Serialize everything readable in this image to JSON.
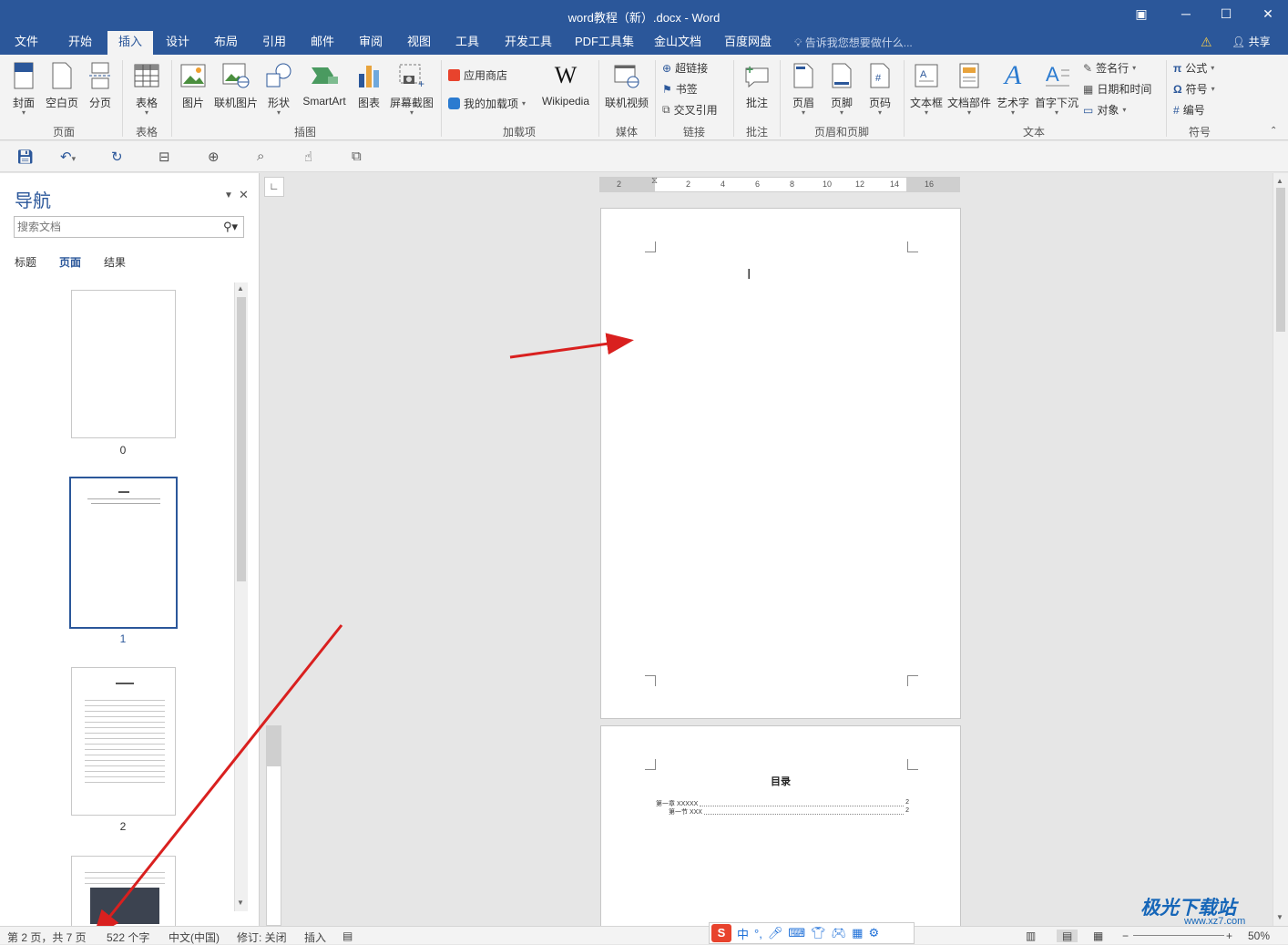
{
  "window": {
    "title": "word教程（新）.docx - Word"
  },
  "tabs": [
    "文件",
    "开始",
    "插入",
    "设计",
    "布局",
    "引用",
    "邮件",
    "审阅",
    "视图",
    "工具",
    "开发工具",
    "PDF工具集",
    "金山文档",
    "百度网盘"
  ],
  "active_tab": "插入",
  "tellme": "告诉我您想要做什么...",
  "share": "共享",
  "ribbon": {
    "pages": {
      "cover": "封面",
      "blank": "空白页",
      "break": "分页",
      "group": "页面"
    },
    "table": {
      "table": "表格",
      "group": "表格"
    },
    "illus": {
      "picture": "图片",
      "online_pic": "联机图片",
      "shapes": "形状",
      "smartart": "SmartArt",
      "chart": "图表",
      "screenshot": "屏幕截图",
      "group": "插图"
    },
    "addins": {
      "store": "应用商店",
      "myaddins": "我的加载项",
      "wikipedia": "Wikipedia",
      "group": "加载项"
    },
    "media": {
      "video": "联机视频",
      "group": "媒体"
    },
    "links": {
      "hyperlink": "超链接",
      "bookmark": "书签",
      "crossref": "交叉引用",
      "group": "链接"
    },
    "comments": {
      "comment": "批注",
      "group": "批注"
    },
    "hf": {
      "header": "页眉",
      "footer": "页脚",
      "pagenum": "页码",
      "group": "页眉和页脚"
    },
    "text": {
      "textbox": "文本框",
      "quickparts": "文档部件",
      "wordart": "艺术字",
      "dropcap": "首字下沉",
      "signature": "签名行",
      "datetime": "日期和时间",
      "object": "对象",
      "group": "文本"
    },
    "symbols": {
      "equation": "公式",
      "symbol": "符号",
      "number": "编号",
      "group": "符号"
    }
  },
  "nav": {
    "title": "导航",
    "search_placeholder": "搜索文档",
    "tabs": [
      "标题",
      "页面",
      "结果"
    ],
    "active_tab": "页面",
    "thumbs": [
      "0",
      "1",
      "2"
    ]
  },
  "doc": {
    "toc_title": "目录",
    "toc_entries": [
      {
        "label": "第一章 XXXXX",
        "page": "2"
      },
      {
        "label": "第一节 XXX",
        "page": "2"
      }
    ],
    "ruler_labels": [
      "2",
      "2",
      "4",
      "6",
      "8",
      "10",
      "12",
      "14",
      "16"
    ]
  },
  "status": {
    "page": "第 2 页，共 7 页",
    "words": "522 个字",
    "lang": "中文(中国)",
    "track": "修订: 关闭",
    "mode": "插入",
    "zoom": "50%"
  },
  "ime": {
    "lang": "中"
  },
  "watermark": {
    "name": "极光下载站",
    "url": "www.xz7.com"
  },
  "colors": {
    "brand": "#2b579a",
    "arrow": "#d9201f",
    "ime_red": "#e8432d"
  }
}
